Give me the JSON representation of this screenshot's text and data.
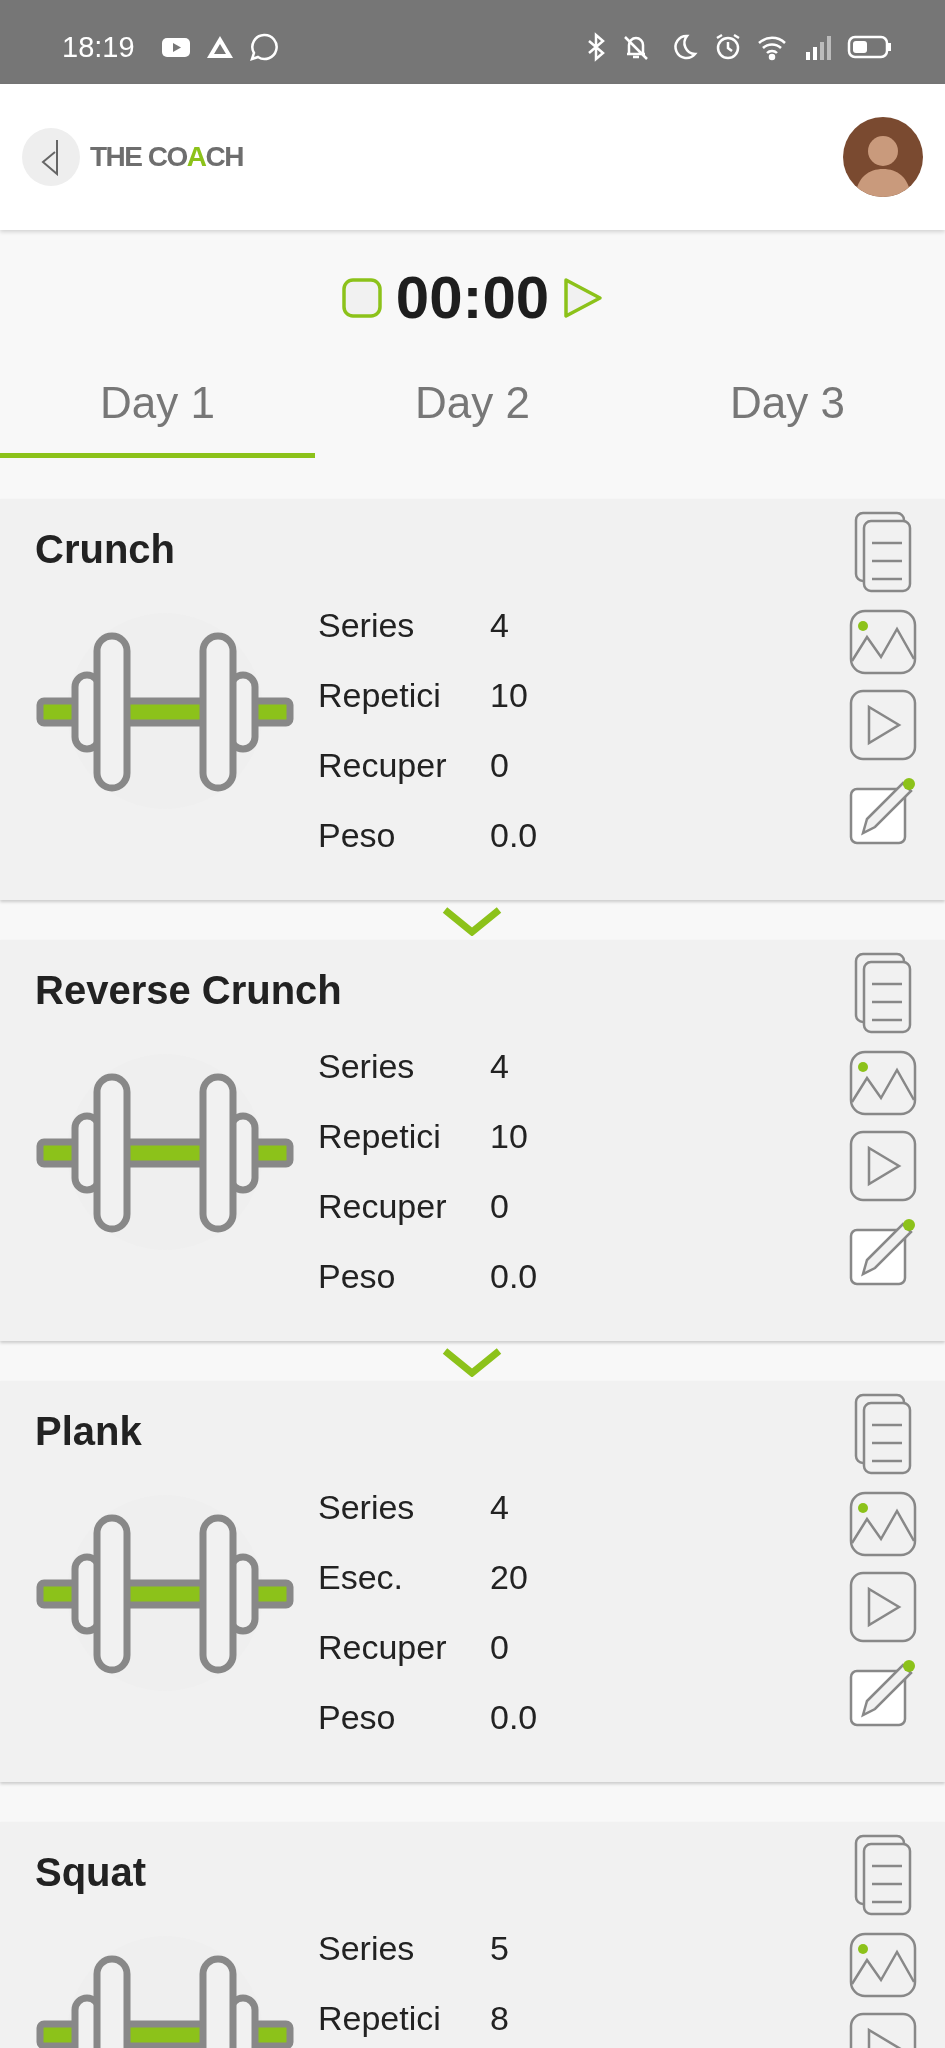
{
  "status_bar": {
    "time": "18:19"
  },
  "header": {
    "logo_parts": [
      "THE CO",
      "A",
      "CH"
    ]
  },
  "timer": {
    "time": "00:00"
  },
  "tabs": [
    {
      "label": "Day 1",
      "selected": true
    },
    {
      "label": "Day 2",
      "selected": false
    },
    {
      "label": "Day 3",
      "selected": false
    }
  ],
  "exercises": [
    {
      "name": "Crunch",
      "linked_next": true,
      "stats": [
        {
          "label": "Series",
          "value": "4"
        },
        {
          "label": "Repetici",
          "value": "10"
        },
        {
          "label": "Recuper",
          "value": "0"
        },
        {
          "label": "Peso",
          "value": "0.0"
        }
      ]
    },
    {
      "name": "Reverse Crunch",
      "linked_next": true,
      "stats": [
        {
          "label": "Series",
          "value": "4"
        },
        {
          "label": "Repetici",
          "value": "10"
        },
        {
          "label": "Recuper",
          "value": "0"
        },
        {
          "label": "Peso",
          "value": "0.0"
        }
      ]
    },
    {
      "name": "Plank",
      "linked_next": false,
      "stats": [
        {
          "label": "Series",
          "value": "4"
        },
        {
          "label": "Esec.",
          "value": "20"
        },
        {
          "label": "Recuper",
          "value": "0"
        },
        {
          "label": "Peso",
          "value": "0.0"
        }
      ]
    },
    {
      "name": "Squat",
      "linked_next": false,
      "stats": [
        {
          "label": "Series",
          "value": "5"
        },
        {
          "label": "Repetici",
          "value": "8"
        }
      ]
    }
  ]
}
